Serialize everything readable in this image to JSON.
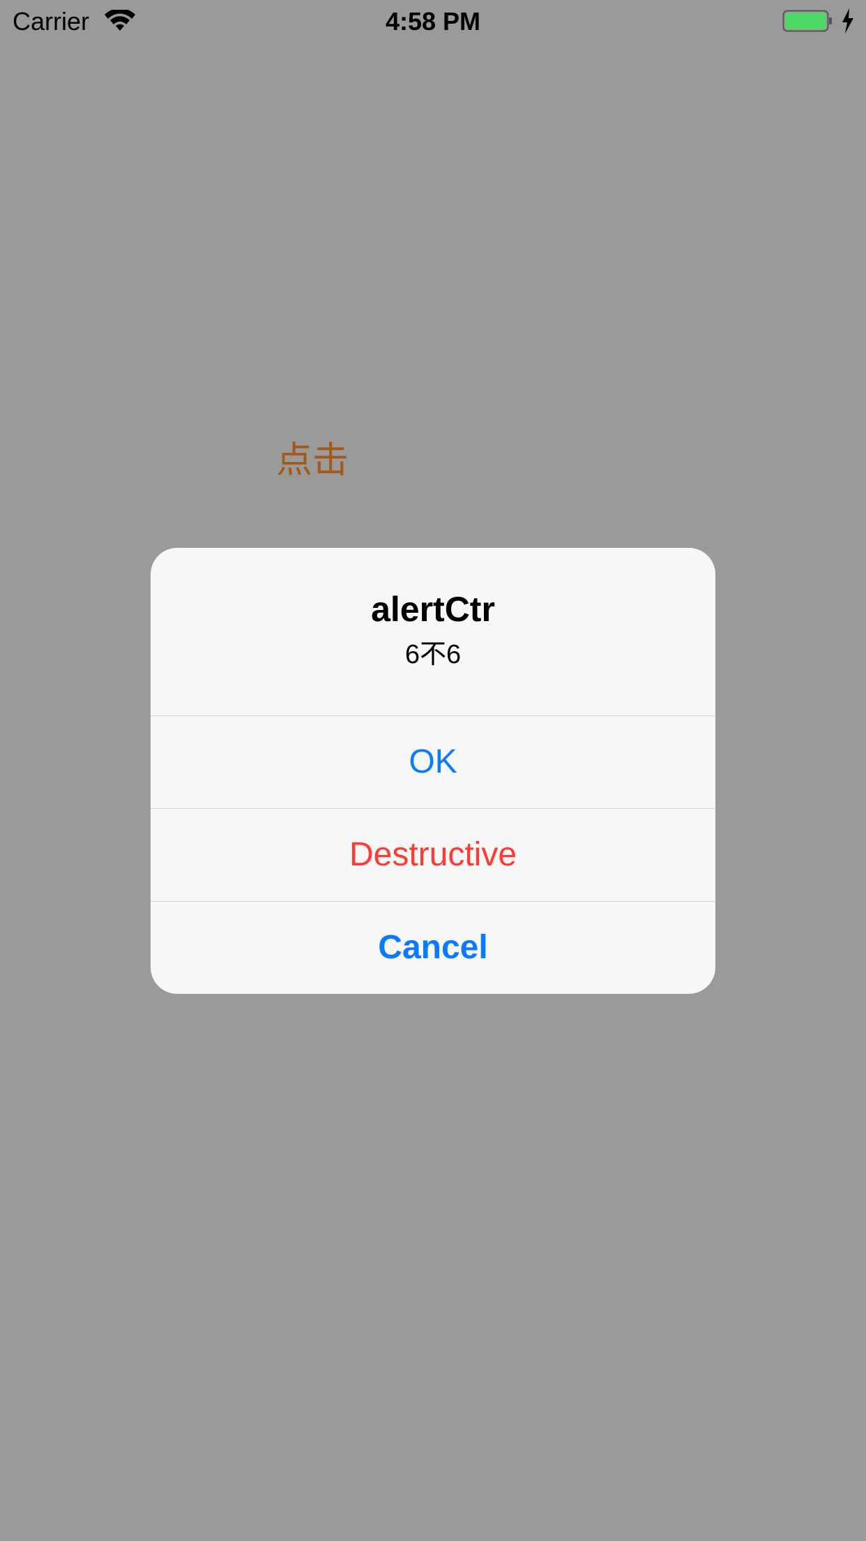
{
  "status_bar": {
    "carrier": "Carrier",
    "time": "4:58 PM",
    "icons": {
      "wifi": "wifi-icon",
      "battery": "battery-icon",
      "charging": "charging-bolt-icon"
    },
    "battery_level": 1.0,
    "battery_color": "#4cd964"
  },
  "background": {
    "trigger_label": "点击",
    "trigger_color": "#a15a17"
  },
  "alert": {
    "title": "alertCtr",
    "message": "6不6",
    "buttons": {
      "ok": "OK",
      "destructive": "Destructive",
      "cancel": "Cancel"
    },
    "colors": {
      "default": "#0a7aff",
      "destructive": "#ff3b30"
    }
  }
}
